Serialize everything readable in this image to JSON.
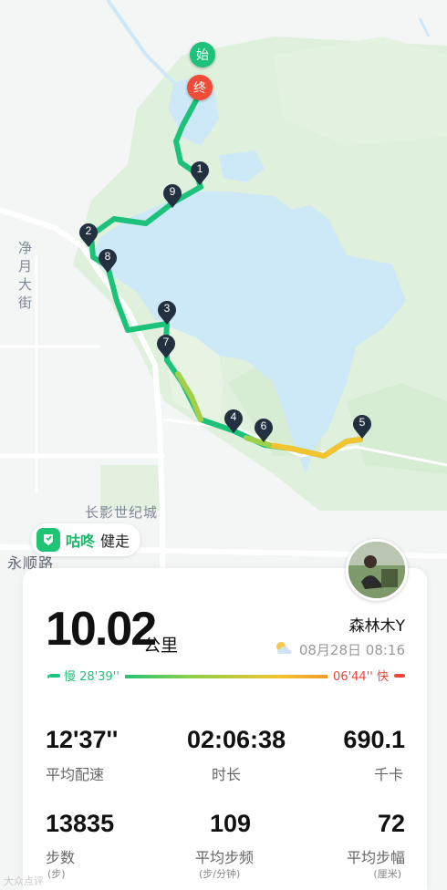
{
  "map": {
    "road_labels": [
      "净月大街",
      "长影世纪城",
      "永顺路"
    ],
    "start_marker": "始",
    "end_marker": "终",
    "km_markers": [
      "1",
      "2",
      "3",
      "4",
      "5",
      "6",
      "7",
      "8",
      "9"
    ],
    "colors": {
      "water": "#cde8f6",
      "park": "#dff0dd",
      "route_green": "#1cc27a",
      "route_yellow": "#f2c42f"
    }
  },
  "brand": {
    "name": "咕咚",
    "mode": "健走",
    "logo_icon": "gudong-logo-icon"
  },
  "summary": {
    "distance": "10.02",
    "distance_unit": "公里",
    "username": "森林木Y",
    "weather_icon": "partly-cloudy-icon",
    "datetime": "08月28日 08:16",
    "pace_slow_label": "慢 28'39''",
    "pace_fast_label": "06'44'' 快"
  },
  "stats": [
    {
      "value": "12'37''",
      "label": "平均配速",
      "sub": ""
    },
    {
      "value": "02:06:38",
      "label": "时长",
      "sub": ""
    },
    {
      "value": "690.1",
      "label": "千卡",
      "sub": ""
    },
    {
      "value": "13835",
      "label": "步数",
      "sub": "(步)"
    },
    {
      "value": "109",
      "label": "平均步频",
      "sub": "(步/分钟)"
    },
    {
      "value": "72",
      "label": "平均步幅",
      "sub": "(厘米)"
    }
  ],
  "watermark": "大众点评"
}
